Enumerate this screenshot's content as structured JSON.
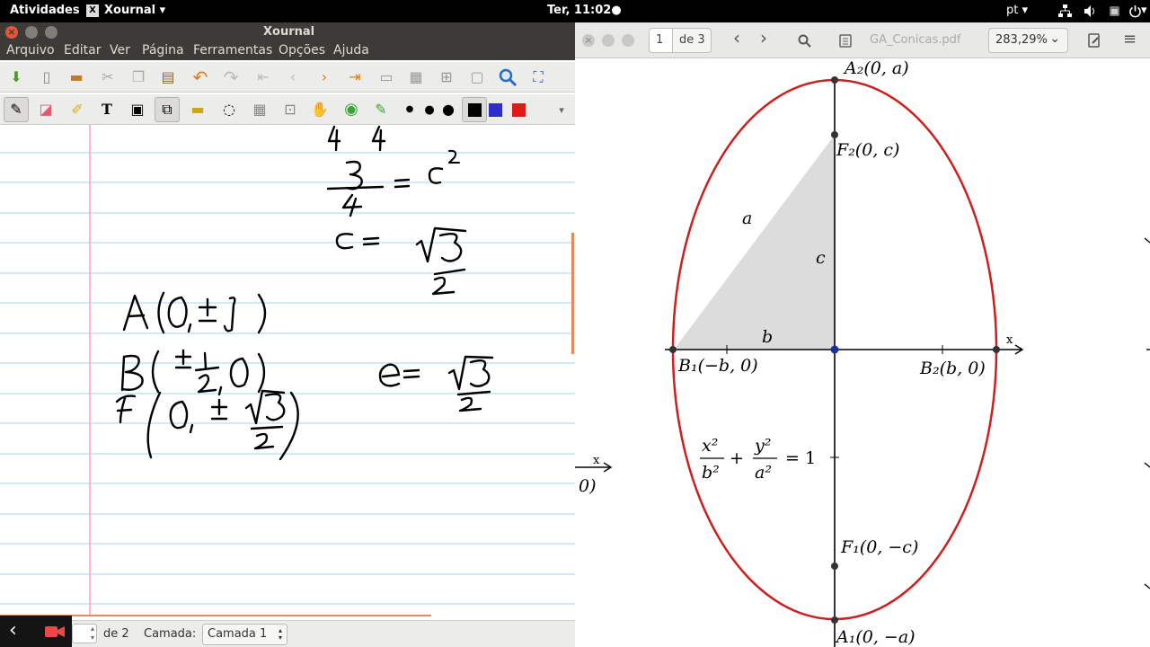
{
  "topbar": {
    "activities": "Atividades",
    "app_name": "Xournal",
    "clock": "Ter, 11:02",
    "language": "pt"
  },
  "xournal": {
    "title": "Xournal",
    "menu": [
      "Arquivo",
      "Editar",
      "Ver",
      "Página",
      "Ferramentas",
      "Opções",
      "Ajuda"
    ],
    "status": {
      "page_total": "de 2",
      "layer_label": "Camada:",
      "layer_value": "Camada 1"
    },
    "colors": {
      "black": "#000000",
      "blue": "#2e2ecc",
      "red": "#e31919",
      "margin": "#ff9ad5",
      "ruling": "#a7d3f1"
    }
  },
  "evince": {
    "page_current": "1",
    "page_total": "de 3",
    "filename": "GA_Conicas.pdf",
    "zoom": "283,29%",
    "figure": {
      "labels": {
        "a2": "A₂(0, a)",
        "f2": "F₂(0, c)",
        "b1": "B₁(−b, 0)",
        "b2": "B₂(b, 0)",
        "f1": "F₁(0, −c)",
        "a1": "A₁(0, −a)",
        "side_a": "a",
        "side_b": "b",
        "side_c": "c",
        "x_axis": "x",
        "eq_x2": "x²",
        "eq_b2": "b²",
        "eq_y2": "y²",
        "eq_a2": "a²",
        "eq_plus": "+",
        "eq_rhs": "= 1",
        "edge_x": "x",
        "edge_paren": "0)"
      },
      "ellipse_color": "#cc1f1f"
    }
  }
}
